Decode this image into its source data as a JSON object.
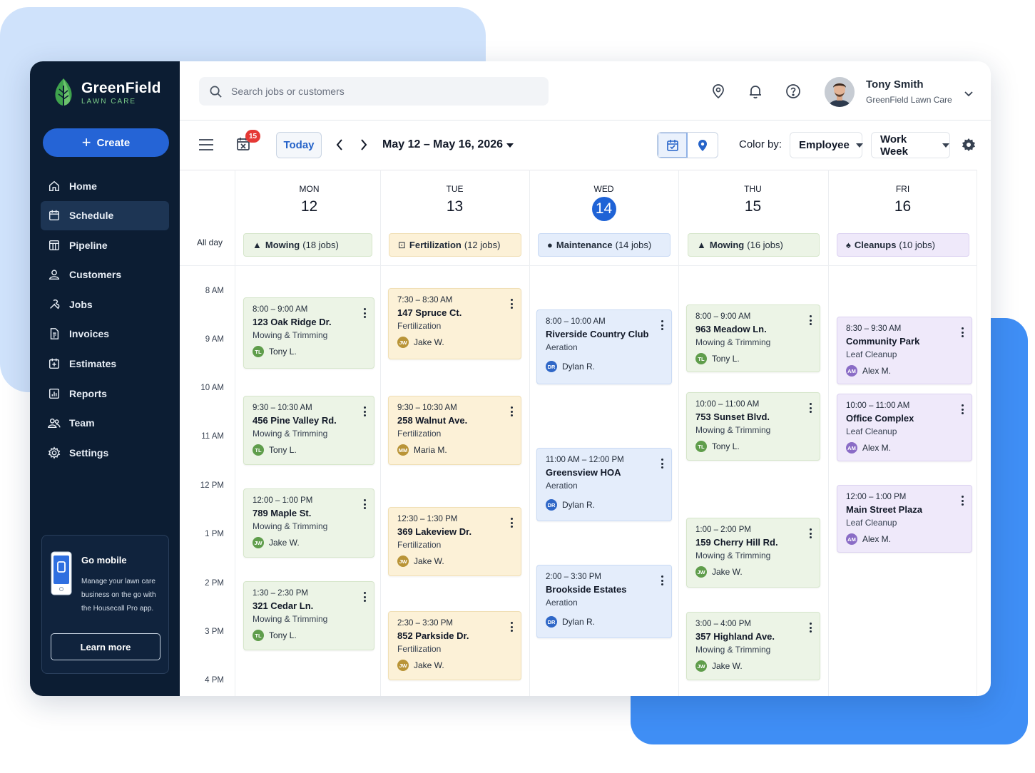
{
  "brand": {
    "name": "GreenField",
    "tagline": "LAWN CARE"
  },
  "sidebar": {
    "create_label": "Create",
    "items": [
      {
        "label": "Home",
        "icon": "home-icon"
      },
      {
        "label": "Schedule",
        "icon": "calendar-icon",
        "active": true
      },
      {
        "label": "Pipeline",
        "icon": "pipeline-icon"
      },
      {
        "label": "Customers",
        "icon": "person-icon"
      },
      {
        "label": "Jobs",
        "icon": "wrench-icon"
      },
      {
        "label": "Invoices",
        "icon": "invoice-icon"
      },
      {
        "label": "Estimates",
        "icon": "estimate-icon"
      },
      {
        "label": "Reports",
        "icon": "reports-icon"
      },
      {
        "label": "Team",
        "icon": "team-icon"
      },
      {
        "label": "Settings",
        "icon": "gear-icon"
      }
    ],
    "mobile": {
      "title": "Go mobile",
      "description": "Manage your lawn care business on the go with the Housecall Pro app.",
      "button": "Learn more"
    }
  },
  "header": {
    "search_placeholder": "Search jobs or customers",
    "user_name": "Tony Smith",
    "user_org": "GreenField Lawn Care"
  },
  "toolbar": {
    "badge_count": "15",
    "today_label": "Today",
    "date_range": "May 12 – May 16, 2026",
    "color_by_label": "Color by:",
    "color_by_value": "Employee",
    "view_value": "Work Week"
  },
  "calendar": {
    "allday_label": "All day",
    "times": [
      "8 AM",
      "9 AM",
      "10 AM",
      "11 AM",
      "12 PM",
      "1 PM",
      "2 PM",
      "3 PM",
      "4 PM"
    ],
    "days": [
      {
        "name": "MON",
        "num": "12",
        "today": false,
        "allday": {
          "category": "Mowing",
          "count": "(18 jobs)",
          "icon": "grass-icon",
          "color": "g"
        }
      },
      {
        "name": "TUE",
        "num": "13",
        "today": false,
        "allday": {
          "category": "Fertilization",
          "count": "(12 jobs)",
          "icon": "fertilizer-icon",
          "color": "y"
        }
      },
      {
        "name": "WED",
        "num": "14",
        "today": true,
        "allday": {
          "category": "Maintenance",
          "count": "(14 jobs)",
          "icon": "drop-icon",
          "color": "b"
        }
      },
      {
        "name": "THU",
        "num": "15",
        "today": false,
        "allday": {
          "category": "Mowing",
          "count": "(16 jobs)",
          "icon": "grass-icon",
          "color": "g"
        }
      },
      {
        "name": "FRI",
        "num": "16",
        "today": false,
        "allday": {
          "category": "Cleanups",
          "count": "(10 jobs)",
          "icon": "leaf-icon",
          "color": "p"
        }
      }
    ],
    "events": [
      [
        {
          "time": "8:00 – 9:00 AM",
          "address": "123 Oak Ridge Dr.",
          "service": "Mowing & Trimming",
          "initials": "TL",
          "tech": "Tony L."
        },
        {
          "time": "9:30 – 10:30 AM",
          "address": "456 Pine Valley Rd.",
          "service": "Mowing & Trimming",
          "initials": "TL",
          "tech": "Tony L."
        },
        {
          "time": "12:00 – 1:00 PM",
          "address": "789 Maple St.",
          "service": "Mowing & Trimming",
          "initials": "JW",
          "tech": "Jake W."
        },
        {
          "time": "1:30 – 2:30 PM",
          "address": "321 Cedar Ln.",
          "service": "Mowing & Trimming",
          "initials": "TL",
          "tech": "Tony L."
        }
      ],
      [
        {
          "time": "7:30 – 8:30 AM",
          "address": "147 Spruce Ct.",
          "service": "Fertilization",
          "initials": "JW",
          "tech": "Jake W."
        },
        {
          "time": "9:30 – 10:30 AM",
          "address": "258 Walnut Ave.",
          "service": "Fertilization",
          "initials": "MM",
          "tech": "Maria M."
        },
        {
          "time": "12:30 – 1:30 PM",
          "address": "369 Lakeview Dr.",
          "service": "Fertilization",
          "initials": "JW",
          "tech": "Jake W."
        },
        {
          "time": "2:30 – 3:30 PM",
          "address": "852 Parkside Dr.",
          "service": "Fertilization",
          "initials": "JW",
          "tech": "Jake W."
        }
      ],
      [
        {
          "time": "8:00 – 10:00 AM",
          "address": "Riverside Country Club",
          "service": "Aeration",
          "initials": "DR",
          "tech": "Dylan R."
        },
        {
          "time": "11:00 AM – 12:00 PM",
          "address": "Greensview HOA",
          "service": "Aeration",
          "initials": "DR",
          "tech": "Dylan R."
        },
        {
          "time": "2:00 – 3:30 PM",
          "address": "Brookside Estates",
          "service": "Aeration",
          "initials": "DR",
          "tech": "Dylan R."
        }
      ],
      [
        {
          "time": "8:00 – 9:00 AM",
          "address": "963 Meadow Ln.",
          "service": "Mowing & Trimming",
          "initials": "TL",
          "tech": "Tony L."
        },
        {
          "time": "10:00 – 11:00 AM",
          "address": "753 Sunset Blvd.",
          "service": "Mowing & Trimming",
          "initials": "TL",
          "tech": "Tony L."
        },
        {
          "time": "1:00 – 2:00 PM",
          "address": "159 Cherry Hill Rd.",
          "service": "Mowing & Trimming",
          "initials": "JW",
          "tech": "Jake W."
        },
        {
          "time": "3:00 – 4:00 PM",
          "address": "357 Highland Ave.",
          "service": "Mowing & Trimming",
          "initials": "JW",
          "tech": "Jake W."
        }
      ],
      [
        {
          "time": "8:30 – 9:30 AM",
          "address": "Community Park",
          "service": "Leaf Cleanup",
          "initials": "AM",
          "tech": "Alex M."
        },
        {
          "time": "10:00 – 11:00 AM",
          "address": "Office Complex",
          "service": "Leaf Cleanup",
          "initials": "AM",
          "tech": "Alex M."
        },
        {
          "time": "12:00 – 1:00 PM",
          "address": "Main Street Plaza",
          "service": "Leaf Cleanup",
          "initials": "AM",
          "tech": "Alex M."
        }
      ]
    ]
  }
}
